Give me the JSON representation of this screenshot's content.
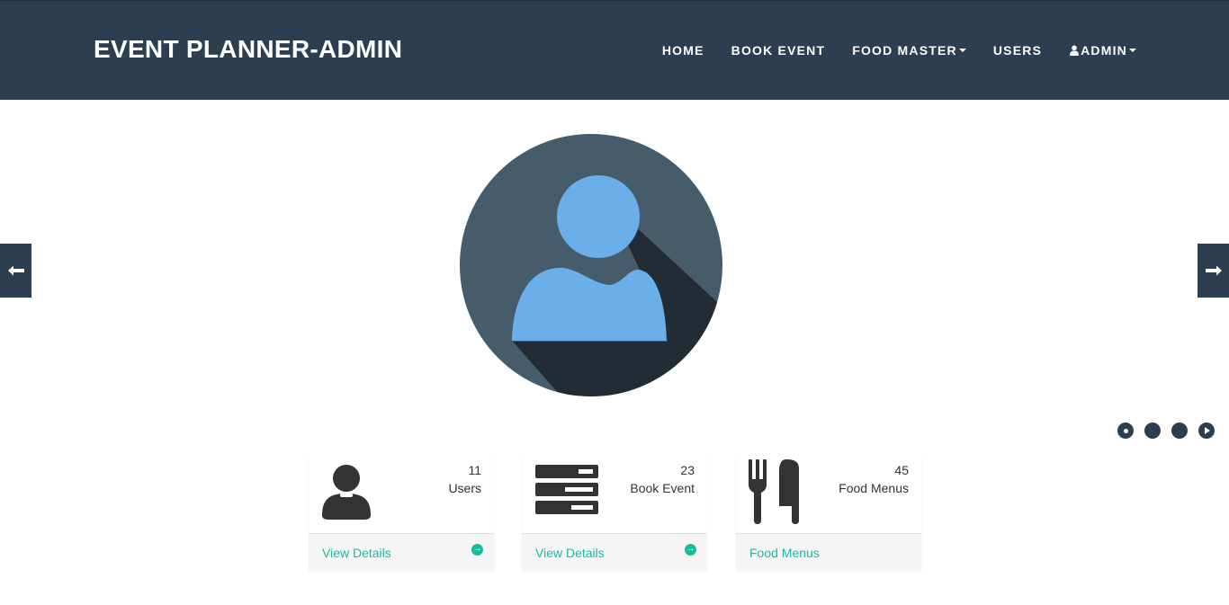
{
  "brand": "EVENT PLANNER-ADMIN",
  "nav": {
    "home": "HOME",
    "book_event": "BOOK EVENT",
    "food_master": "FOOD MASTER",
    "users": "USERS",
    "admin": "ADMIN"
  },
  "carousel": {
    "prev_icon": "arrow-left-icon",
    "next_icon": "arrow-right-icon",
    "indicators": 3,
    "active_index": 0
  },
  "panels": [
    {
      "icon": "user-icon",
      "count": "11",
      "label": "Users",
      "footer": "View Details",
      "footer_icon": "arrow-circle-right-icon"
    },
    {
      "icon": "list-icon",
      "count": "23",
      "label": "Book Event",
      "footer": "View Details",
      "footer_icon": "arrow-circle-right-icon"
    },
    {
      "icon": "cutlery-icon",
      "count": "45",
      "label": "Food Menus",
      "footer": "Food Menus"
    }
  ],
  "colors": {
    "navbar": "#2c3e50",
    "accent": "#18bc9c",
    "avatar_bg": "#475c6a",
    "avatar_figure": "#6aaeea",
    "avatar_shadow": "#232c35"
  }
}
